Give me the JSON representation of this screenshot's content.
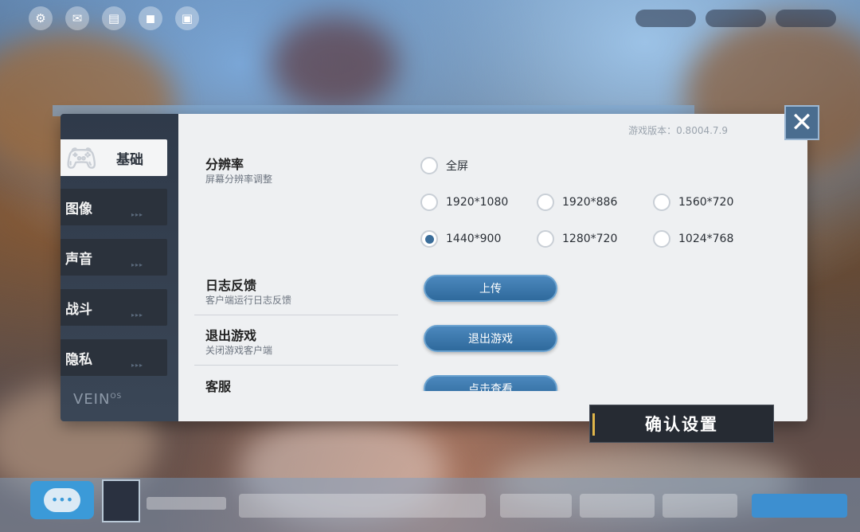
{
  "tabs": [
    {
      "label": "基础",
      "active": true
    },
    {
      "label": "图像",
      "active": false
    },
    {
      "label": "声音",
      "active": false
    },
    {
      "label": "战斗",
      "active": false
    },
    {
      "label": "隐私",
      "active": false
    }
  ],
  "tab_arrows": "▸▸▸",
  "logo_text": "VEIN",
  "logo_sup": "OS",
  "version_text": "游戏版本：0.8004.7.9",
  "resolution": {
    "title": "分辨率",
    "subtitle": "屏幕分辨率调整",
    "options": [
      "全屏",
      "1920*1080",
      "1920*886",
      "1560*720",
      "1440*900",
      "1280*720",
      "1024*768"
    ],
    "selected": "1440*900"
  },
  "log_feedback": {
    "title": "日志反馈",
    "subtitle": "客户端运行日志反馈",
    "button": "上传"
  },
  "exit_game": {
    "title": "退出游戏",
    "subtitle": "关闭游戏客户端",
    "button": "退出游戏"
  },
  "customer_service": {
    "title": "客服",
    "button": "点击查看"
  },
  "confirm_label": "确认设置",
  "close_glyph": "✕",
  "icons": {
    "gamepad": "gamepad-icon",
    "close": "close-icon",
    "chat": "chat-icon"
  },
  "colors": {
    "accent": "#3c8ad0",
    "button": "#2f6a9c",
    "sidebar": "#2f3a4a",
    "confirm_accent": "#e0b64a"
  }
}
